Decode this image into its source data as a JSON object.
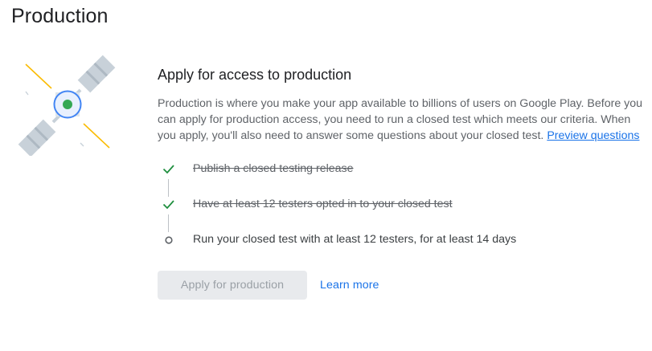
{
  "page": {
    "title": "Production"
  },
  "illustration": {
    "icon": "satellite-icon",
    "colors": {
      "panel": "#c8d1d9",
      "panel_stripe": "#aeb9c3",
      "ring": "#4285f4",
      "core": "#34a853",
      "beam": "#fbbc04"
    }
  },
  "card": {
    "heading": "Apply for access to production",
    "description_lines": [
      "Production is where you make your app available to billions of users on Google Play. Before you",
      "can apply for production access, you need to run a closed test which meets our criteria. When",
      "you apply, you'll also need to answer some questions about your closed test."
    ],
    "preview_link": "Preview questions"
  },
  "checklist": [
    {
      "label": "Publish a closed testing release",
      "status": "done",
      "icon": "check-icon"
    },
    {
      "label": "Have at least 12 testers opted in to your closed test",
      "status": "done",
      "icon": "check-icon"
    },
    {
      "label": "Run your closed test with at least 12 testers, for at least 14 days",
      "status": "pending",
      "icon": "empty-circle-icon"
    }
  ],
  "actions": {
    "apply_label": "Apply for production",
    "apply_disabled": true,
    "learn_more_label": "Learn more"
  },
  "colors": {
    "check": "#1e8e3e",
    "pending": "#5f6368",
    "link": "#1a73e8",
    "disabled_bg": "#e8eaed",
    "disabled_text": "#9aa0a6"
  }
}
